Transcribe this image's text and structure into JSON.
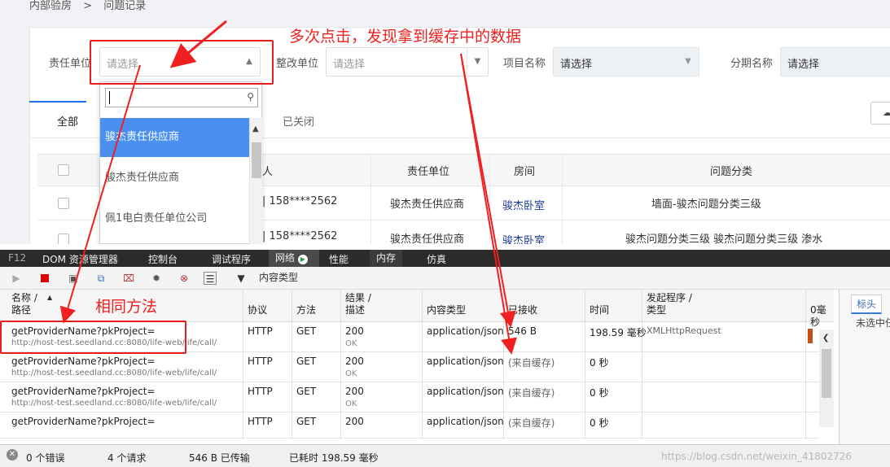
{
  "breadcrumb": [
    "内部验房",
    "问题记录"
  ],
  "filters": {
    "responsible": {
      "label": "责任单位",
      "placeholder": "请选择"
    },
    "rectify": {
      "label": "整改单位",
      "placeholder": "请选择"
    },
    "project": {
      "label": "项目名称",
      "placeholder": "请选择"
    },
    "phase": {
      "label": "分期名称",
      "placeholder": "请选择"
    }
  },
  "tabs": [
    "全部",
    "已关闭"
  ],
  "dropdown": {
    "options": [
      "骏杰责任供应商",
      "骏杰责任供应商",
      "佩1电白责任单位公司"
    ],
    "selected_index": 0
  },
  "table": {
    "headers": [
      "人",
      "责任单位",
      "房间",
      "问题分类"
    ],
    "rows": [
      {
        "phone": "| 158****2562",
        "unit": "骏杰责任供应商",
        "room": "骏杰卧室",
        "category": "墙面-骏杰问题分类三级"
      },
      {
        "phone": "| 158****2562",
        "unit": "骏杰责任供应商",
        "room": "骏杰卧室",
        "category": "骏杰问题分类三级 骏杰问题分类三级 渗水"
      }
    ]
  },
  "devtools": {
    "tabs": [
      "F12",
      "DOM 资源管理器",
      "控制台",
      "调试程序",
      "网络",
      "性能",
      "内存",
      "仿真"
    ],
    "active_tab": "网络",
    "content_type_label": "内容类型",
    "columns": [
      "名称 /\n路径",
      "协议",
      "方法",
      "结果 /\n描述",
      "内容类型",
      "已接收",
      "时间",
      "发起程序 /\n类型",
      "0毫秒"
    ],
    "requests": [
      {
        "name": "getProviderName?pkProject=",
        "path": "http://host-test.seedland.cc:8080/life-web/life/call/",
        "protocol": "HTTP",
        "method": "GET",
        "status": "200",
        "desc": "OK",
        "type": "application/json",
        "received": "546 B",
        "time": "198.59 毫秒",
        "initiator": "XMLHttpRequest"
      },
      {
        "name": "getProviderName?pkProject=",
        "path": "http://host-test.seedland.cc:8080/life-web/life/call/",
        "protocol": "HTTP",
        "method": "GET",
        "status": "200",
        "desc": "OK",
        "type": "application/json",
        "received": "(来自缓存)",
        "time": "0 秒",
        "initiator": ""
      },
      {
        "name": "getProviderName?pkProject=",
        "path": "http://host-test.seedland.cc:8080/life-web/life/call/",
        "protocol": "HTTP",
        "method": "GET",
        "status": "200",
        "desc": "OK",
        "type": "application/json",
        "received": "(来自缓存)",
        "time": "0 秒",
        "initiator": ""
      },
      {
        "name": "getProviderName?pkProject=",
        "path": "",
        "protocol": "HTTP",
        "method": "GET",
        "status": "200",
        "desc": "",
        "type": "application/json",
        "received": "(来自缓存)",
        "time": "0 秒",
        "initiator": ""
      }
    ],
    "side_panel": {
      "tab": "标头",
      "text": "未选中任"
    },
    "status": {
      "errors": "0 个错误",
      "requests": "4 个请求",
      "transferred": "546 B 已传输",
      "elapsed": "已耗时 198.59 毫秒"
    }
  },
  "annotations": {
    "top": "多次点击，发现拿到缓存中的数据",
    "left": "相同方法"
  },
  "watermark": "https://blog.csdn.net/weixin_41802726",
  "colors": {
    "accent": "#4a90f0",
    "annotation": "#e61e1e",
    "devtools_bar": "#2b2b2b"
  }
}
